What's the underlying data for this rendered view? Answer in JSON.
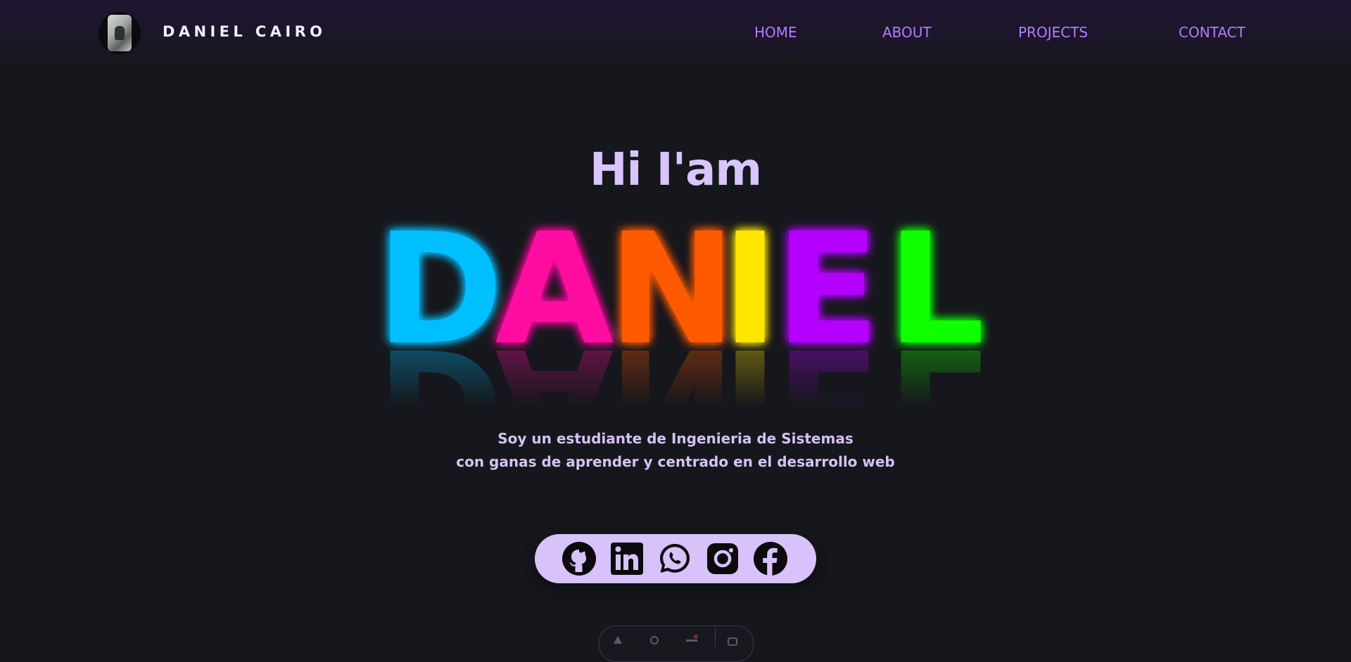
{
  "header": {
    "brand": "DANIEL CAIRO",
    "avatar_icon": "profile-photo",
    "nav": [
      "HOME",
      "ABOUT",
      "PROJECTS",
      "CONTACT"
    ]
  },
  "hero": {
    "greeting": "Hi I'am",
    "name_letters": [
      {
        "char": "D",
        "color": "#00bfff"
      },
      {
        "char": "A",
        "color": "#ff0fa0"
      },
      {
        "char": "N",
        "color": "#ff5a00"
      },
      {
        "char": "I",
        "color": "#ffe600"
      },
      {
        "char": "E",
        "color": "#b300ff"
      },
      {
        "char": "L",
        "color": "#11ff00"
      }
    ],
    "bio_line_1": "Soy un estudiante de Ingenieria de Sistemas",
    "bio_line_2": "con ganas de aprender y centrado en el desarrollo web"
  },
  "social": {
    "icons": [
      "github-icon",
      "linkedin-icon",
      "whatsapp-icon",
      "instagram-icon",
      "facebook-icon"
    ]
  },
  "colors": {
    "background": "#16171c",
    "accent": "#b47cff",
    "text_light": "#d9c4fb",
    "social_bar": "#d8c2f9"
  }
}
